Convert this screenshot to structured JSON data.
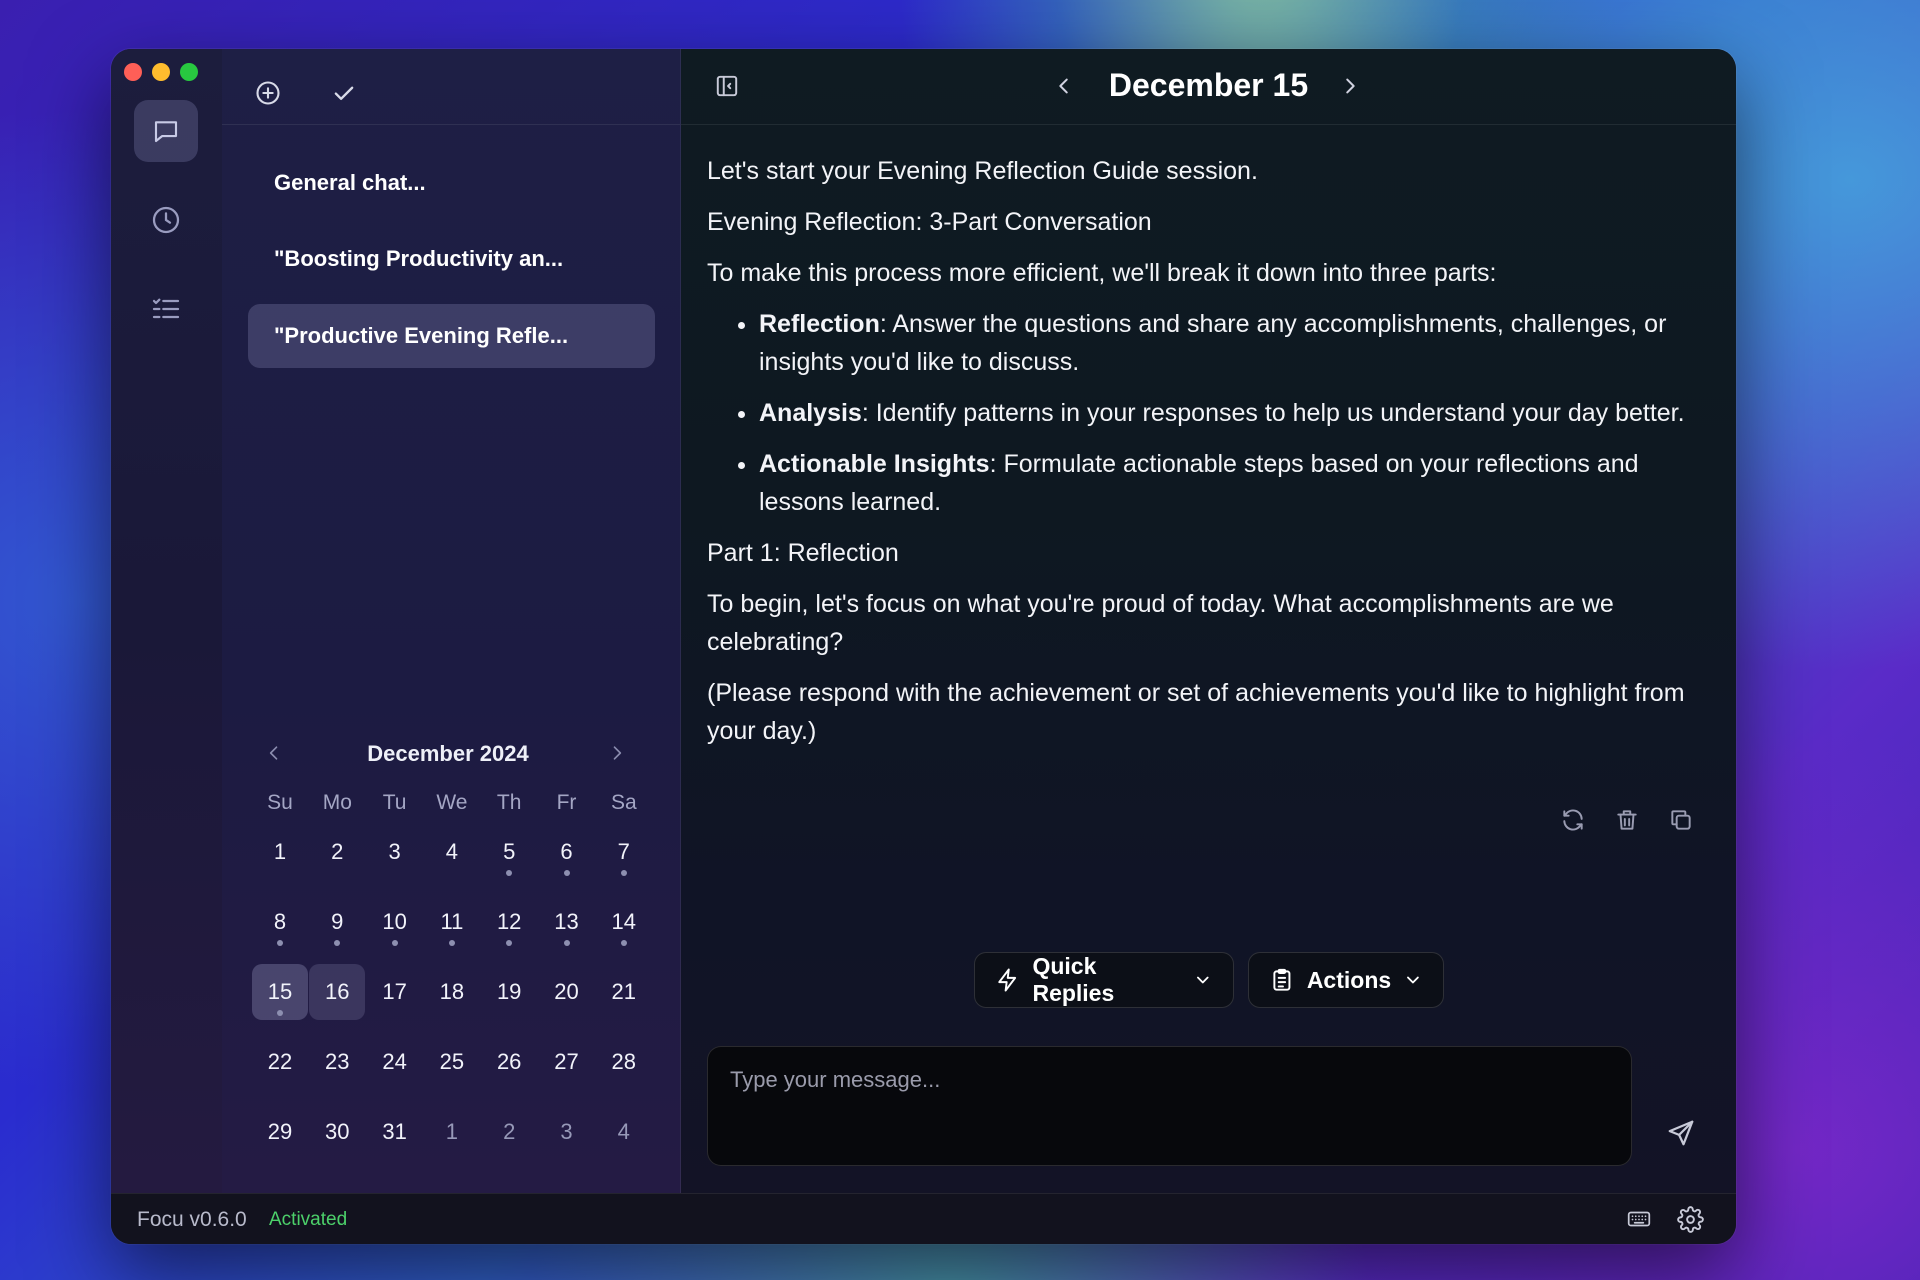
{
  "colors": {
    "close": "#fe5f57",
    "minimize": "#febc2e",
    "maximize": "#28c840",
    "accent_green": "#4cd06a"
  },
  "rail": {
    "icons": [
      "chat-bubble-icon",
      "clock-icon",
      "checklist-icon"
    ]
  },
  "sidebar": {
    "toolbar_icons": [
      "plus-circle-icon",
      "checkmark-icon"
    ],
    "chats": [
      {
        "label": "General chat..."
      },
      {
        "label": "\"Boosting Productivity an..."
      },
      {
        "label": "\"Productive Evening Refle..."
      }
    ]
  },
  "calendar": {
    "title": "December 2024",
    "weekdays": [
      "Su",
      "Mo",
      "Tu",
      "We",
      "Th",
      "Fr",
      "Sa"
    ],
    "weeks": [
      [
        "1",
        "2",
        "3",
        "4",
        "5",
        "6",
        "7"
      ],
      [
        "8",
        "9",
        "10",
        "11",
        "12",
        "13",
        "14"
      ],
      [
        "15",
        "16",
        "17",
        "18",
        "19",
        "20",
        "21"
      ],
      [
        "22",
        "23",
        "24",
        "25",
        "26",
        "27",
        "28"
      ],
      [
        "29",
        "30",
        "31",
        "1",
        "2",
        "3",
        "4"
      ]
    ],
    "selected_day": "15",
    "today": "16",
    "days_with_entries": [
      "5",
      "6",
      "7",
      "8",
      "9",
      "10",
      "11",
      "12",
      "13",
      "14",
      "15"
    ]
  },
  "main": {
    "date_title": "December 15",
    "message": {
      "p1": "Let's start your Evening Reflection Guide session.",
      "p2": "Evening Reflection: 3-Part Conversation",
      "p3": "To make this process more efficient, we'll break it down into three parts:",
      "bullets": [
        {
          "term": "Reflection",
          "text": ": Answer the questions and share any accomplishments, challenges, or insights you'd like to discuss."
        },
        {
          "term": "Analysis",
          "text": ": Identify patterns in your responses to help us understand your day better."
        },
        {
          "term": "Actionable Insights",
          "text": ": Formulate actionable steps based on your reflections and lessons learned."
        }
      ],
      "p4": "Part 1: Reflection",
      "p5": "To begin, let's focus on what you're proud of today. What accomplishments are we celebrating?",
      "p6": "(Please respond with the achievement or set of achievements you'd like to highlight from your day.)"
    },
    "quick_replies_label": "Quick Replies",
    "actions_label": "Actions",
    "input_placeholder": "Type your message..."
  },
  "status": {
    "version": "Focu v0.6.0",
    "state": "Activated"
  }
}
